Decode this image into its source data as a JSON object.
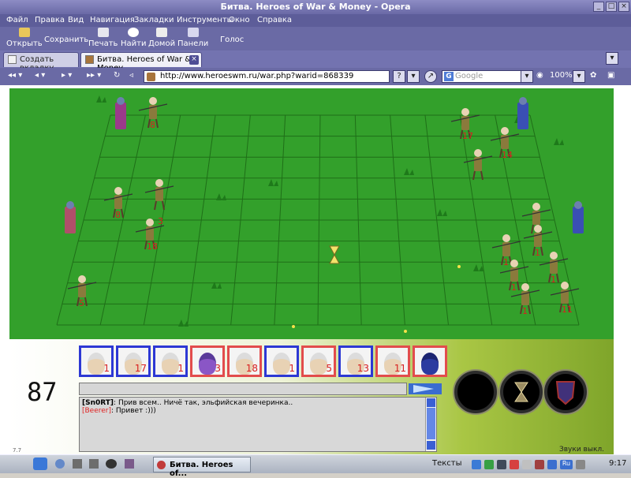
{
  "browser": {
    "window_title": "Битва. Heroes of War & Money - Opera",
    "menu": [
      "Файл",
      "Правка",
      "Вид",
      "Навигация",
      "Закладки",
      "Инструменты",
      "Окно",
      "Справка"
    ],
    "toolbar": {
      "open": "Открыть",
      "save": "Сохранить",
      "print": "Печать",
      "find": "Найти",
      "home": "Домой",
      "panels": "Панели",
      "voice": "Голос"
    },
    "tabs": {
      "new_tab": "Создать вкладку",
      "active": "Битва. Heroes of War & Money"
    },
    "address": "http://www.heroeswm.ru/war.php?warid=868339",
    "search_placeholder": "Google",
    "zoom": "100%"
  },
  "battle": {
    "turn_number": "87",
    "left_units": [
      {
        "count": "8"
      },
      {
        "count": "8"
      },
      {
        "count": "3"
      },
      {
        "count": "18"
      },
      {
        "count": "5"
      }
    ],
    "right_units": [
      {
        "count": "17"
      },
      {
        "count": "14"
      },
      {
        "count": "1"
      },
      {
        "count": "1"
      },
      {
        "count": "1"
      },
      {
        "count": "1"
      },
      {
        "count": "1"
      },
      {
        "count": "11"
      }
    ],
    "queue": [
      {
        "count": "1",
        "side": "blue"
      },
      {
        "count": "17",
        "side": "blue"
      },
      {
        "count": "1",
        "side": "blue"
      },
      {
        "count": "3",
        "side": "red"
      },
      {
        "count": "18",
        "side": "red"
      },
      {
        "count": "1",
        "side": "blue"
      },
      {
        "count": "5",
        "side": "red"
      },
      {
        "count": "13",
        "side": "blue"
      },
      {
        "count": "11",
        "side": "red"
      },
      {
        "count": "",
        "side": "red"
      }
    ],
    "chat": [
      {
        "user": "[Sn0RT]",
        "text": ": Прив всем.. Ничё так, эльфийская вечеринка..",
        "user_color": "#1a1a8a"
      },
      {
        "user": "[Beerer]",
        "text": ": Привет :)))",
        "user_color": "#e02424"
      }
    ],
    "sounds_label": "Звуки выкл.",
    "version": "7.7"
  },
  "taskbar": {
    "task_title": "Битва. Heroes of...",
    "texts_label": "Тексты",
    "clock": "9:17",
    "lang": "Ru"
  },
  "colors": {
    "grass": "#33a02b",
    "grid_line": "#1f6e18",
    "unit_count": "#d82020",
    "queue_blue": "#2d38d4",
    "queue_red": "#e24c4c"
  }
}
